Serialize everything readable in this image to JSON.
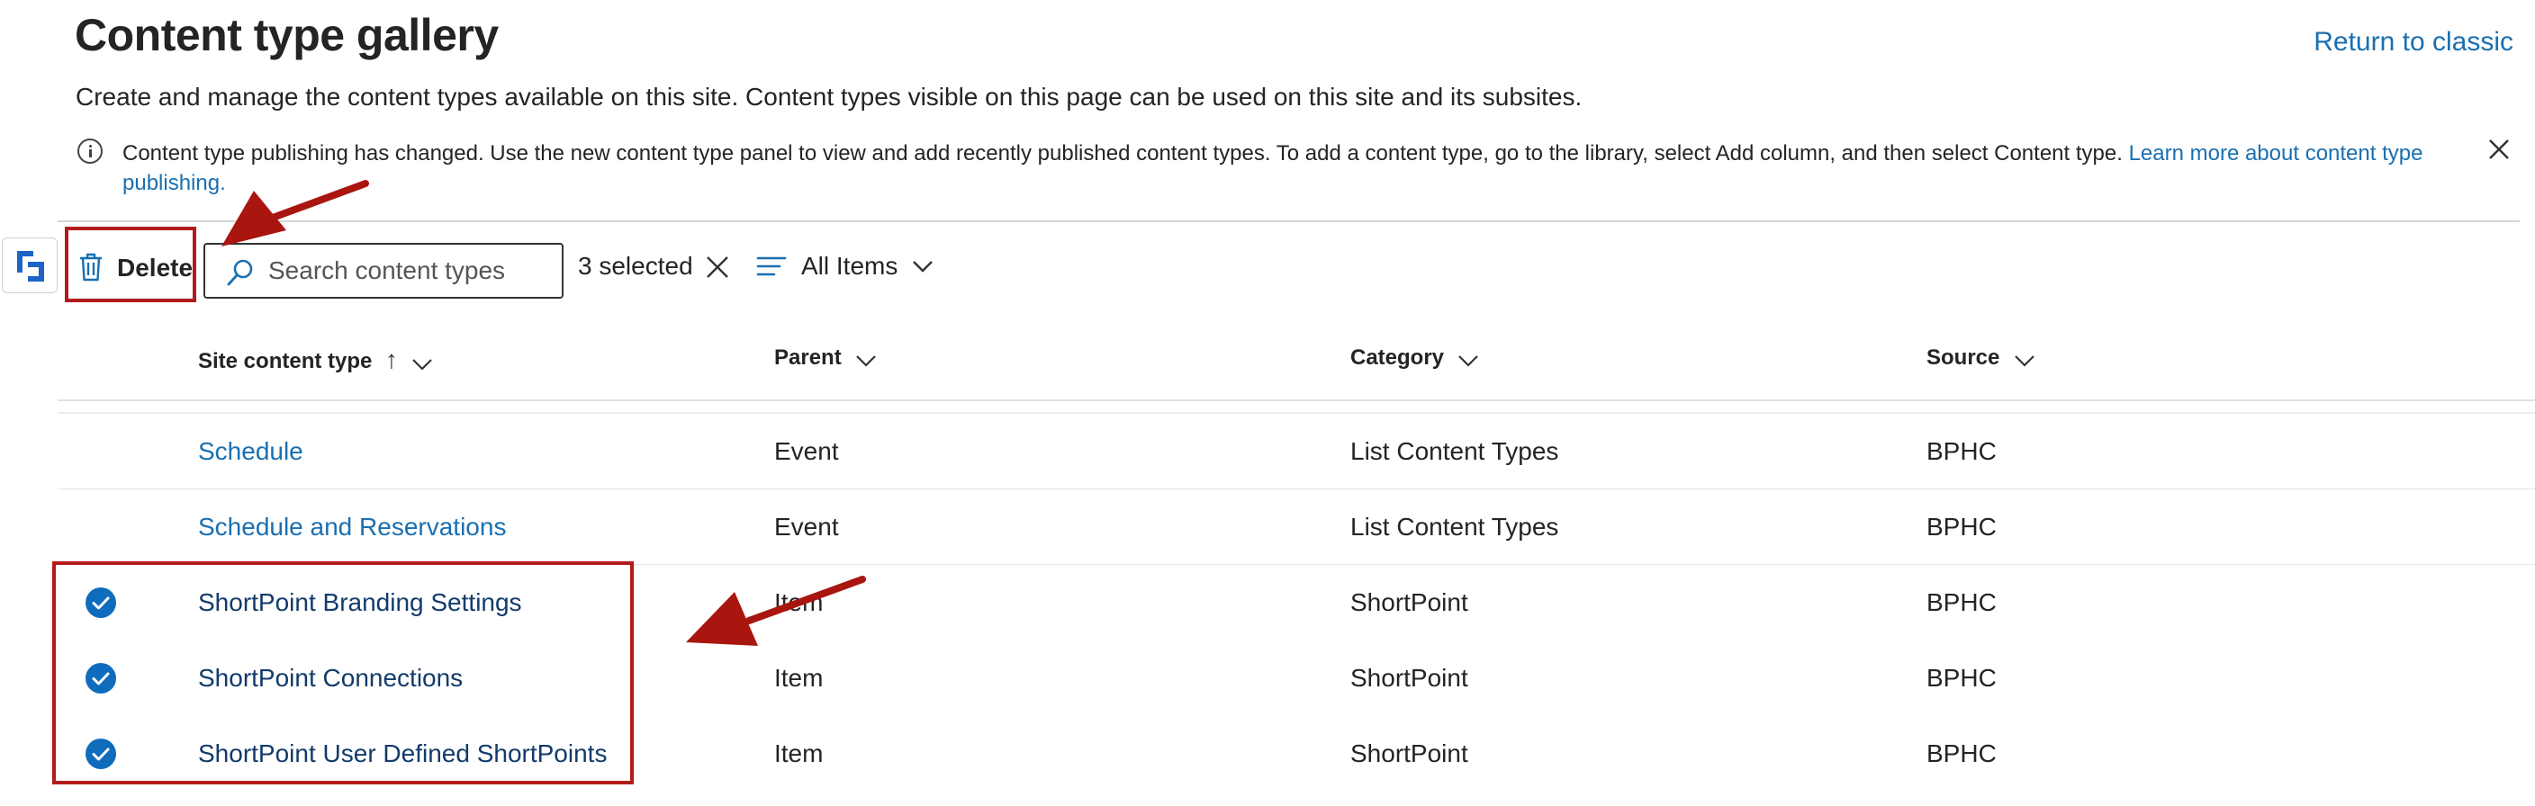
{
  "header": {
    "title": "Content type gallery",
    "return_link": "Return to classic",
    "subtitle": "Create and manage the content types available on this site. Content types visible on this page can be used on this site and its subsites."
  },
  "info_bar": {
    "message": "Content type publishing has changed. Use the new content type panel to view and add recently published content types. To add a content type, go to the library, select Add column, and then select Content type.",
    "link_text": "Learn more about content type publishing."
  },
  "toolbar": {
    "delete_label": "Delete",
    "search_placeholder": "Search content types",
    "selected_count": "3 selected",
    "view_label": "All Items"
  },
  "table": {
    "columns": [
      "Site content type",
      "Parent",
      "Category",
      "Source"
    ],
    "sort_indicator": "↑",
    "rows": [
      {
        "name": "Schedule",
        "parent": "Event",
        "category": "List Content Types",
        "source": "BPHC",
        "selected": false
      },
      {
        "name": "Schedule and Reservations",
        "parent": "Event",
        "category": "List Content Types",
        "source": "BPHC",
        "selected": false
      },
      {
        "name": "ShortPoint Branding Settings",
        "parent": "Item",
        "category": "ShortPoint",
        "source": "BPHC",
        "selected": true
      },
      {
        "name": "ShortPoint Connections",
        "parent": "Item",
        "category": "ShortPoint",
        "source": "BPHC",
        "selected": true
      },
      {
        "name": "ShortPoint User Defined ShortPoints",
        "parent": "Item",
        "category": "ShortPoint",
        "source": "BPHC",
        "selected": true
      }
    ]
  },
  "colors": {
    "link": "#1a6fb0",
    "check": "#0f6cbd",
    "annotation": "#b31b1b"
  },
  "icons": [
    "info-icon",
    "close-icon",
    "trash-icon",
    "search-icon",
    "list-view-icon",
    "chevron-down-icon",
    "checkmark-circle-icon",
    "app-logo"
  ]
}
